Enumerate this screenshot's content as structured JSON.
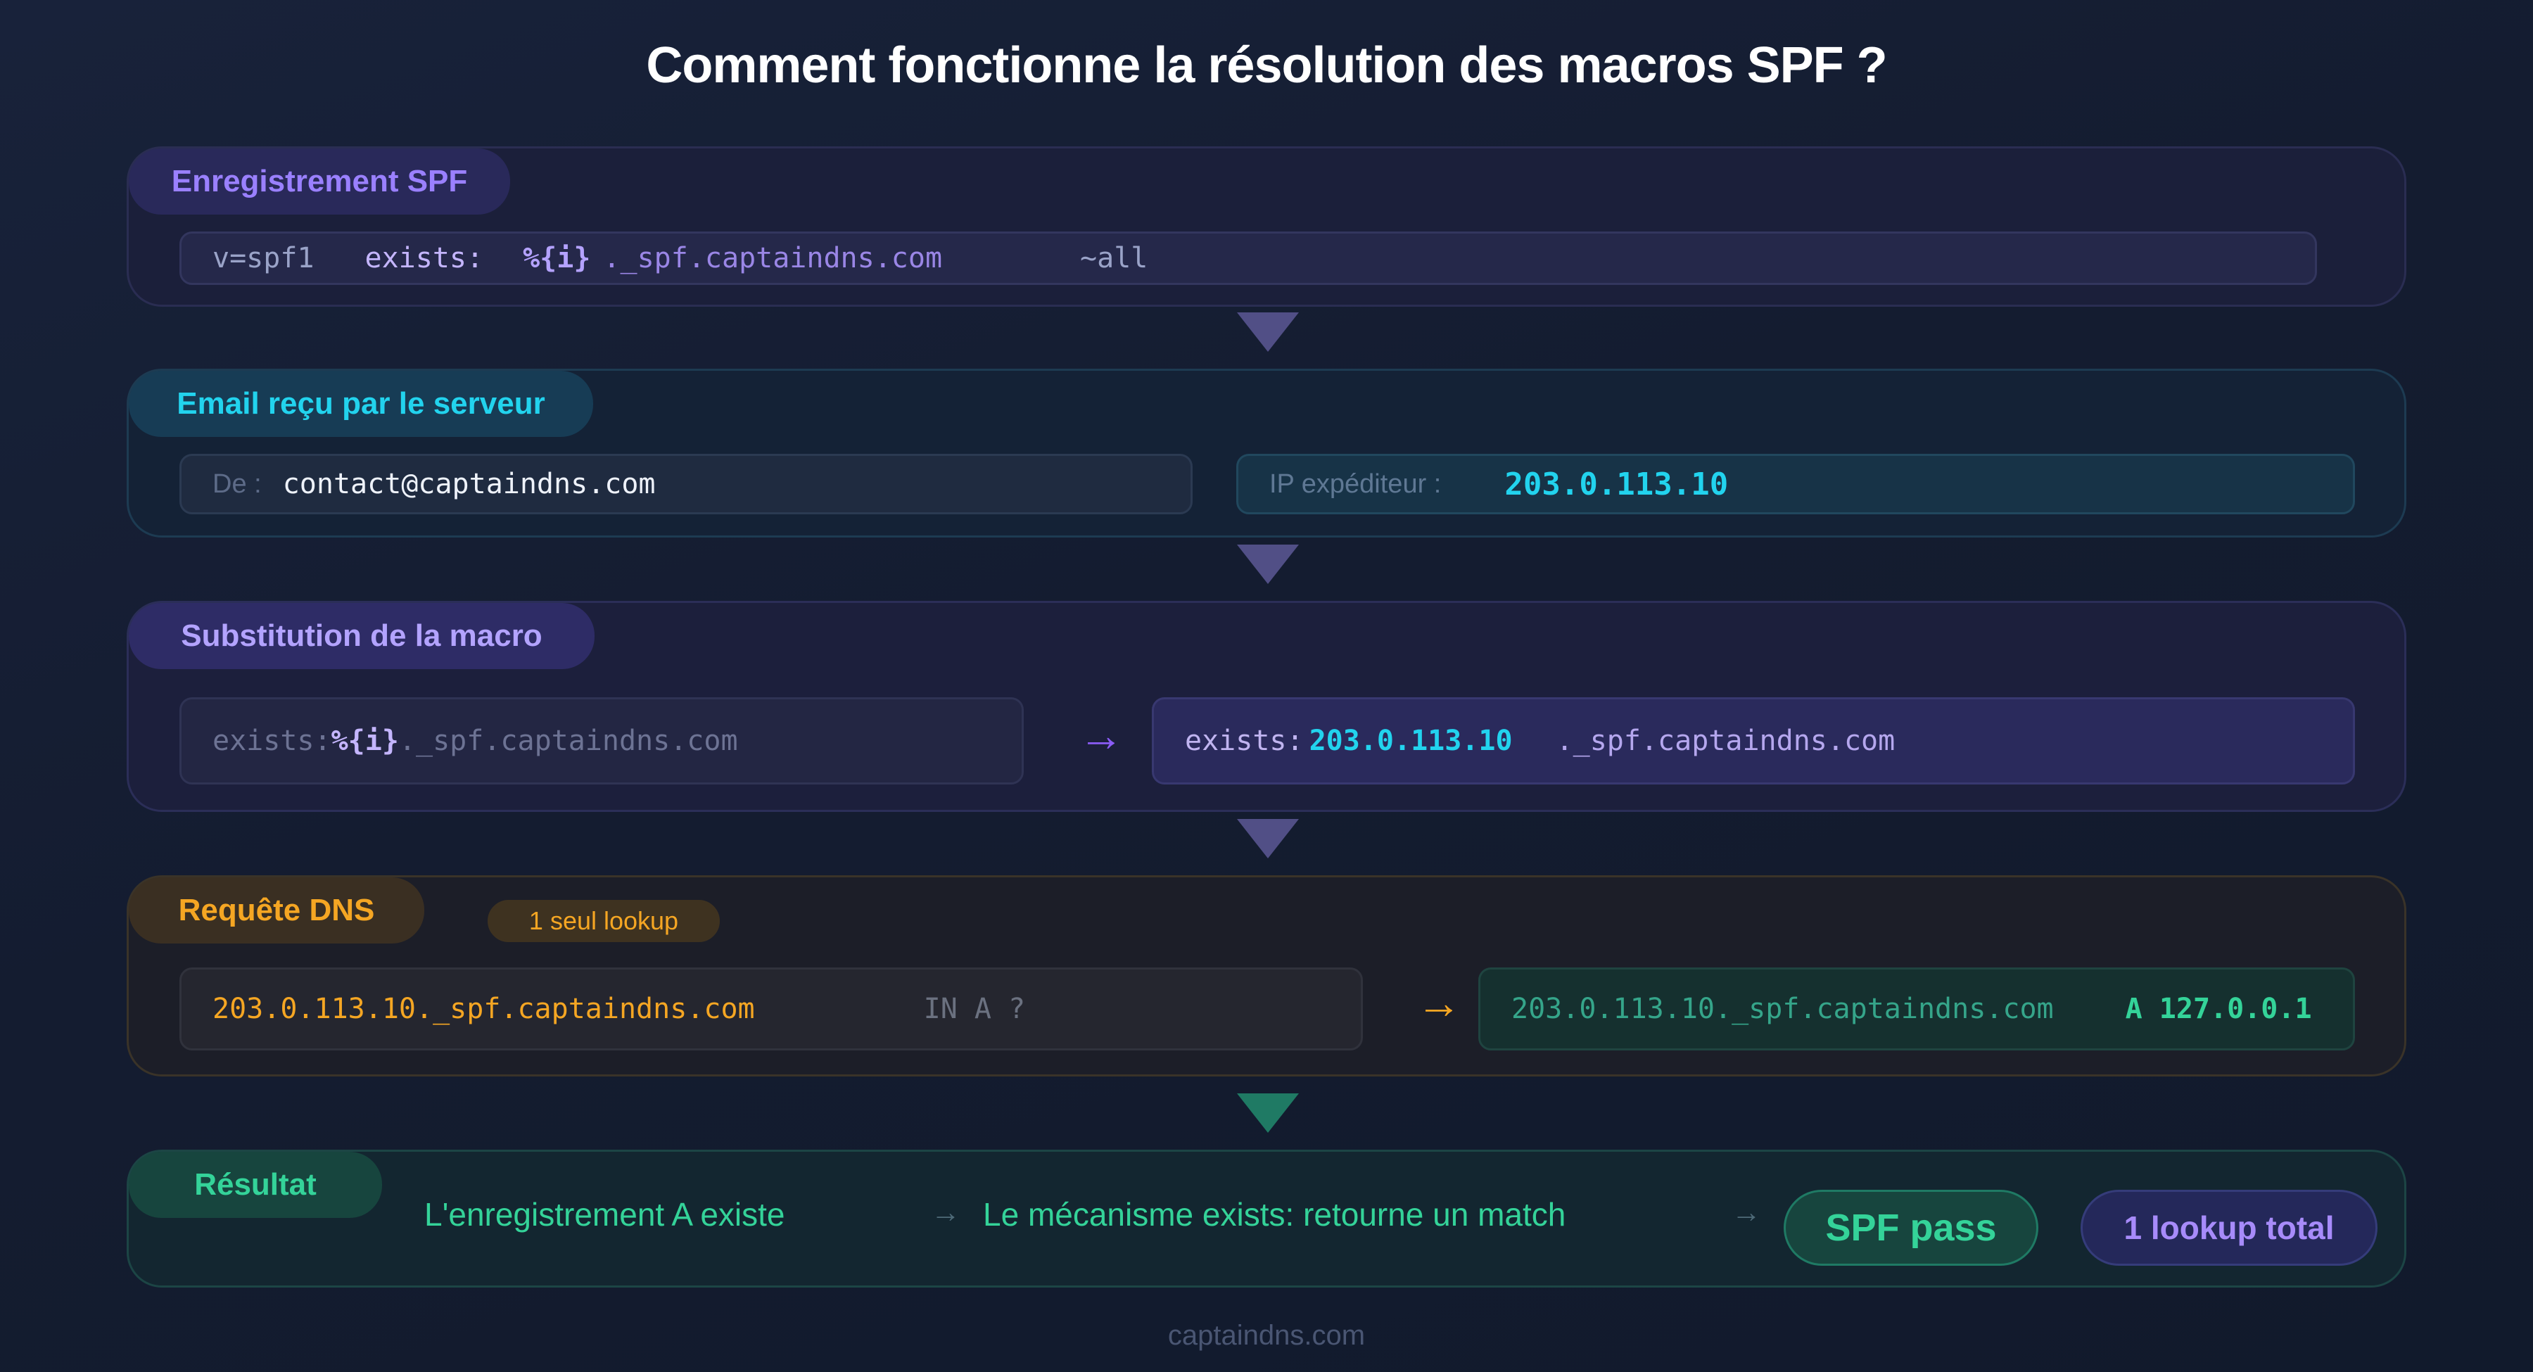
{
  "title": "Comment fonctionne la résolution des macros SPF ?",
  "footer": "captaindns.com",
  "sections": {
    "record": {
      "label": "Enregistrement SPF",
      "tokens": [
        "v=spf1",
        "exists:",
        "%{i}",
        "._spf.captaindns.com",
        "~all"
      ]
    },
    "email": {
      "label": "Email reçu par le serveur",
      "from_label": "De :",
      "from_value": "contact@captaindns.com",
      "ip_label": "IP expéditeur :",
      "ip_value": "203.0.113.10"
    },
    "substitution": {
      "label": "Substitution de la macro",
      "before": [
        "exists:",
        "%{i}",
        "._spf.captaindns.com"
      ],
      "arrow": "→",
      "after": [
        "exists:",
        "203.0.113.10",
        "._spf.captaindns.com"
      ]
    },
    "dns": {
      "label": "Requête DNS",
      "badge": "1 seul lookup",
      "query_name": "203.0.113.10._spf.captaindns.com",
      "query_type": "IN A ?",
      "arrow": "→",
      "answer_name": "203.0.113.10._spf.captaindns.com",
      "answer_value": "A 127.0.0.1"
    },
    "result": {
      "label": "Résultat",
      "step1": "L'enregistrement A existe",
      "arrow1": "→",
      "step2": "Le mécanisme exists: retourne un match",
      "arrow2": "→",
      "pass_badge": "SPF pass",
      "lookup_badge": "1 lookup total"
    }
  },
  "colors": {
    "purple": "#9a80ff",
    "cyan": "#22d3ee",
    "orange": "#f5a623",
    "green": "#34d399",
    "connector": "#514f86",
    "connector_green": "#1f7a64"
  }
}
